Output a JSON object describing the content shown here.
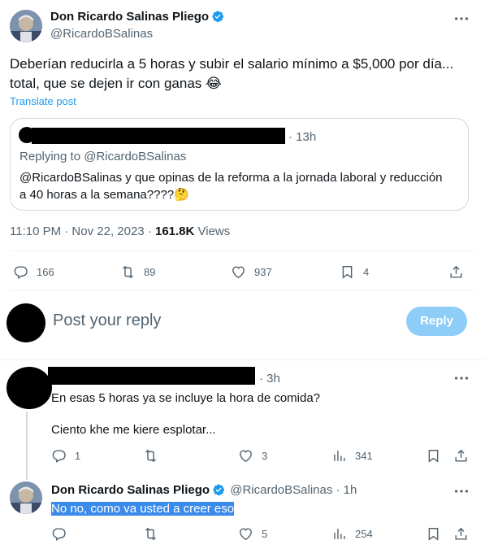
{
  "main_tweet": {
    "author_name": "Don Ricardo Salinas Pliego",
    "handle": "@RicardoBSalinas",
    "text_line1": "Deberían reducirla a 5 horas y subir el salario mínimo a $5,000 por día...",
    "text_line2": "total, que se dejen ir con ganas",
    "emoji": "😂",
    "translate_label": "Translate post",
    "quote": {
      "time": "· 13h",
      "replying_to": "Replying to @RicardoBSalinas",
      "text_line1": "@RicardoBSalinas  y que opinas de la reforma a la jornada laboral y reducción",
      "text_line2": "a 40 horas a la semana????",
      "emoji": "🤔"
    },
    "timestamp": "11:10 PM · Nov 22, 2023 · ",
    "views_count": "161.8K",
    "views_label": " Views",
    "actions": {
      "replies": "166",
      "retweets": "89",
      "likes": "937",
      "bookmarks": "4"
    }
  },
  "compose": {
    "placeholder": "Post your reply",
    "button_label": "Reply"
  },
  "reply1": {
    "time": "· 3h",
    "text_line1": "En esas 5 horas ya se incluye la hora de comida?",
    "text_line2": "Ciento khe me kiere esplotar...",
    "actions": {
      "replies": "1",
      "retweets": "",
      "likes": "3",
      "views": "341"
    }
  },
  "reply2": {
    "author_name": "Don Ricardo Salinas Pliego",
    "handle": "@RicardoBSalinas",
    "time": "· 1h",
    "text": "No no, como va usted a creer eso",
    "actions": {
      "replies": "",
      "retweets": "",
      "likes": "5",
      "views": "254"
    }
  },
  "colors": {
    "accent": "#1d9bf0",
    "reply_button": "#8ecdf8",
    "selection": "#3b8beb",
    "muted_text": "#536471"
  }
}
